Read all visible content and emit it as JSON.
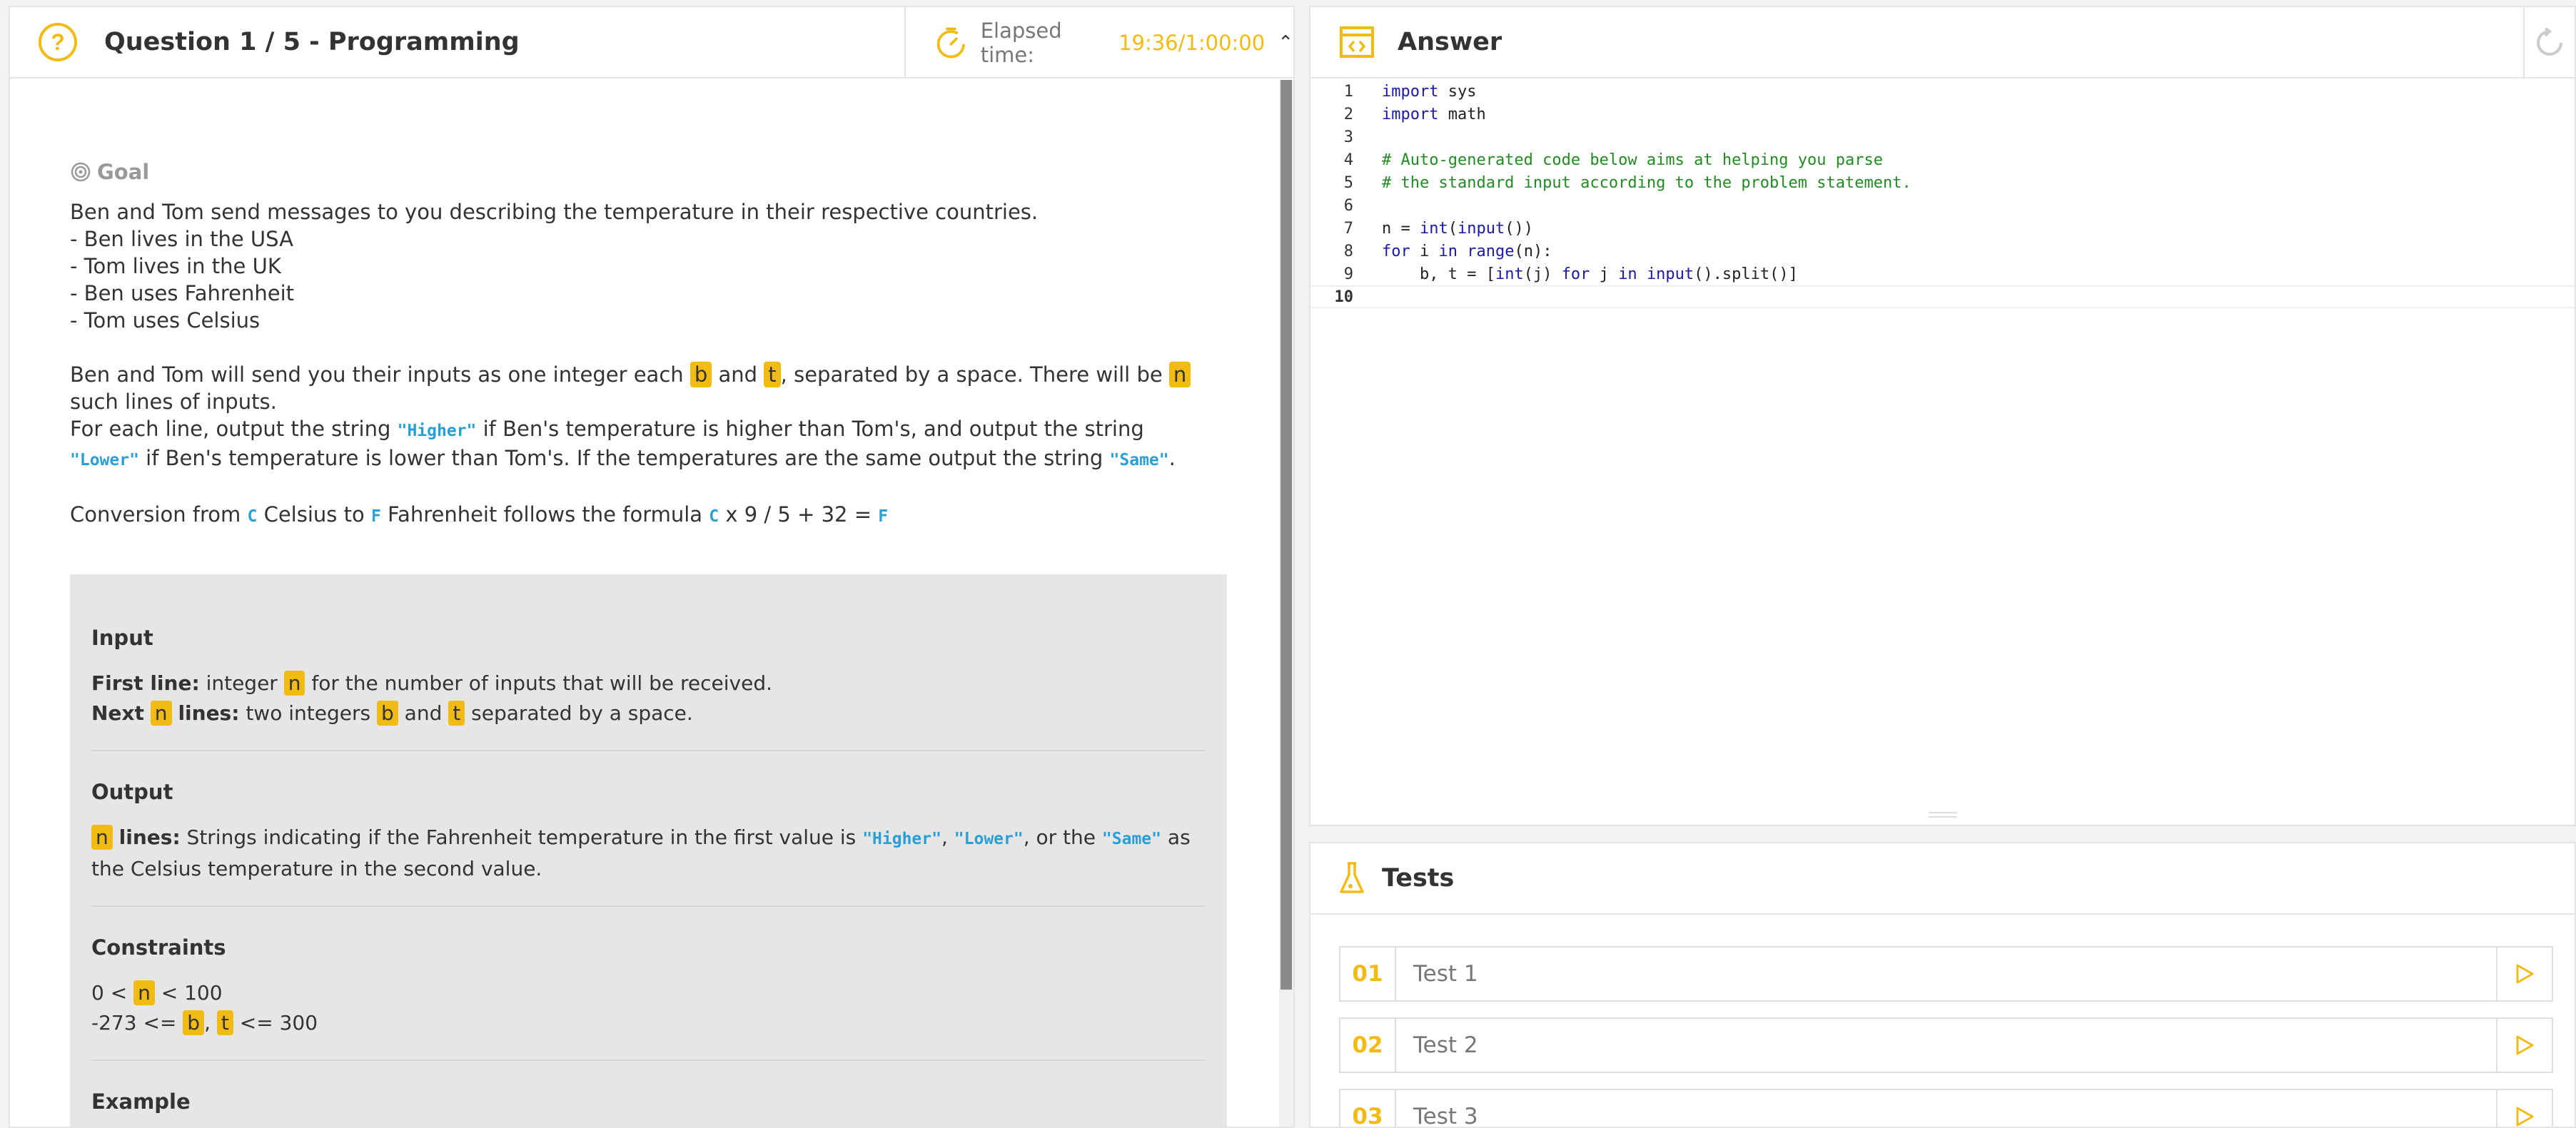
{
  "question": {
    "title": "Question 1 / 5 - Programming",
    "timer_label": "Elapsed time:",
    "timer_value": "19:36/1:00:00",
    "goal_label": "Goal",
    "intro_lines": [
      "Ben and Tom send messages to you describing the temperature in their respective countries.",
      "- Ben lives in the USA",
      "- Tom lives in the UK",
      "- Ben uses Fahrenheit",
      "- Tom uses Celsius"
    ],
    "p1_a": "Ben and Tom will send you their inputs as one integer each",
    "p1_b": "and",
    "p1_c": ", separated by a space. There will be",
    "p1_d": "such lines of",
    "p1_e": "inputs.",
    "p2_a": "For each line, output the string",
    "p2_b": "if Ben's temperature is higher than Tom's, and output the string",
    "p2_c": "if Ben's",
    "p2_d": "temperature is lower than Tom's. If the temperatures are the same output the string",
    "p2_e": ".",
    "p3_a": "Conversion from",
    "p3_b": "Celsius to",
    "p3_c": "Fahrenheit follows the formula",
    "p3_d": "x 9 / 5 + 32 =",
    "var_n": "n",
    "var_b": "b",
    "var_t": "t",
    "const_higher": "\"Higher\"",
    "const_lower": "\"Lower\"",
    "const_same": "\"Same\"",
    "const_c": "C",
    "const_f": "F",
    "input_title": "Input",
    "input_first_bold": "First line:",
    "input_first_a": "integer",
    "input_first_b": "for the number of inputs that will be received.",
    "input_next_bold_a": "Next",
    "input_next_bold_b": "lines:",
    "input_next_a": "two integers",
    "input_next_b": "and",
    "input_next_c": "separated by a space.",
    "output_title": "Output",
    "output_bold": "lines:",
    "output_a": "Strings indicating if the Fahrenheit temperature in the first value is",
    "output_comma": ",",
    "output_b": ", or the",
    "output_c": "as the",
    "output_d": "Celsius temperature in the second value.",
    "constraints_title": "Constraints",
    "c1_a": "0 <",
    "c1_b": "< 100",
    "c2_a": "-273 <=",
    "c2_comma": ",",
    "c2_b": "<= 300",
    "example_title": "Example"
  },
  "answer": {
    "title": "Answer",
    "code_lines": [
      {
        "n": "1",
        "text": "import sys"
      },
      {
        "n": "2",
        "text": "import math"
      },
      {
        "n": "3",
        "text": ""
      },
      {
        "n": "4",
        "text": "# Auto-generated code below aims at helping you parse"
      },
      {
        "n": "5",
        "text": "# the standard input according to the problem statement."
      },
      {
        "n": "6",
        "text": ""
      },
      {
        "n": "7",
        "text": "n = int(input())"
      },
      {
        "n": "8",
        "text": "for i in range(n):"
      },
      {
        "n": "9",
        "text": "    b, t = [int(j) for j in input().split()]"
      },
      {
        "n": "10",
        "text": ""
      }
    ]
  },
  "tests": {
    "title": "Tests",
    "items": [
      {
        "num": "01",
        "label": "Test 1"
      },
      {
        "num": "02",
        "label": "Test 2"
      },
      {
        "num": "03",
        "label": "Test 3"
      }
    ]
  },
  "colors": {
    "accent": "#f2bb13",
    "constant": "#2a9fd6",
    "keyword": "#1a1aa6",
    "comment": "#228b22"
  }
}
